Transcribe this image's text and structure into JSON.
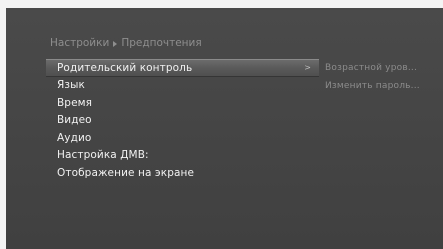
{
  "breadcrumb": {
    "root": "Настройки",
    "current": "Предпочтения"
  },
  "menu": {
    "items": [
      {
        "label": "Родительский контроль"
      },
      {
        "label": "Язык"
      },
      {
        "label": "Время"
      },
      {
        "label": "Видео"
      },
      {
        "label": "Аудио"
      },
      {
        "label": "Настройка ДМВ:"
      },
      {
        "label": "Отображение на экране"
      }
    ],
    "arrow": ">"
  },
  "submenu": {
    "items": [
      {
        "label": "Возрастной уров..."
      },
      {
        "label": "Изменить пароль..."
      }
    ]
  },
  "colors": {
    "background": "#454545",
    "text": "#f2f2f2",
    "dim_text": "#8e8e8e"
  }
}
